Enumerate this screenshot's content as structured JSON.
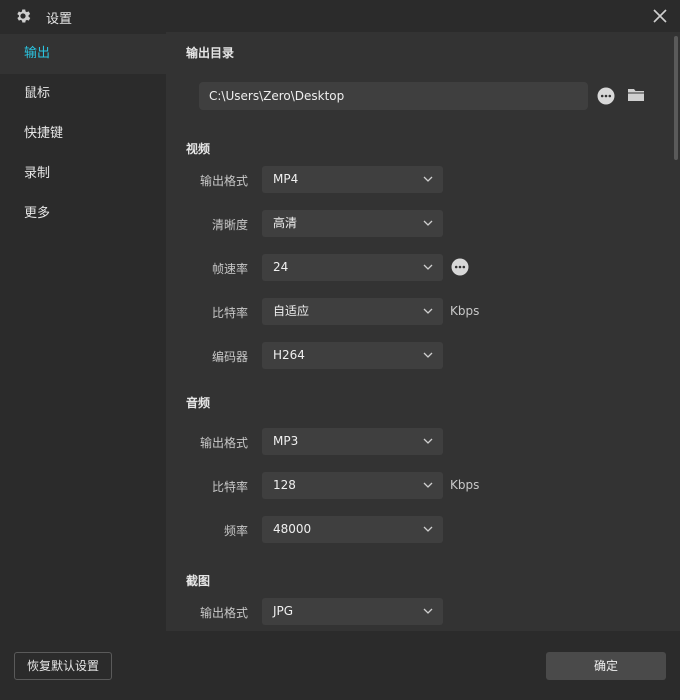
{
  "window": {
    "title": "设置",
    "close_icon": "close-icon"
  },
  "sidebar": {
    "items": [
      {
        "label": "输出",
        "active": true
      },
      {
        "label": "鼠标"
      },
      {
        "label": "快捷键"
      },
      {
        "label": "录制"
      },
      {
        "label": "更多"
      }
    ]
  },
  "output_dir": {
    "title": "输出目录",
    "path": "C:\\Users\\Zero\\Desktop"
  },
  "video": {
    "title": "视频",
    "format": {
      "label": "输出格式",
      "value": "MP4"
    },
    "quality": {
      "label": "清晰度",
      "value": "高清"
    },
    "fps": {
      "label": "帧速率",
      "value": "24"
    },
    "bitrate": {
      "label": "比特率",
      "value": "自适应",
      "unit": "Kbps"
    },
    "encoder": {
      "label": "编码器",
      "value": "H264"
    }
  },
  "audio": {
    "title": "音频",
    "format": {
      "label": "输出格式",
      "value": "MP3"
    },
    "bitrate": {
      "label": "比特率",
      "value": "128",
      "unit": "Kbps"
    },
    "frequency": {
      "label": "频率",
      "value": "48000"
    }
  },
  "screenshot": {
    "title": "截图",
    "format": {
      "label": "输出格式",
      "value": "JPG"
    }
  },
  "footer": {
    "reset_label": "恢复默认设置",
    "ok_label": "确定"
  },
  "colors": {
    "accent": "#2bc4e0",
    "background": "#2b2b2b",
    "panel": "#333333",
    "field": "#3f3f3f"
  }
}
